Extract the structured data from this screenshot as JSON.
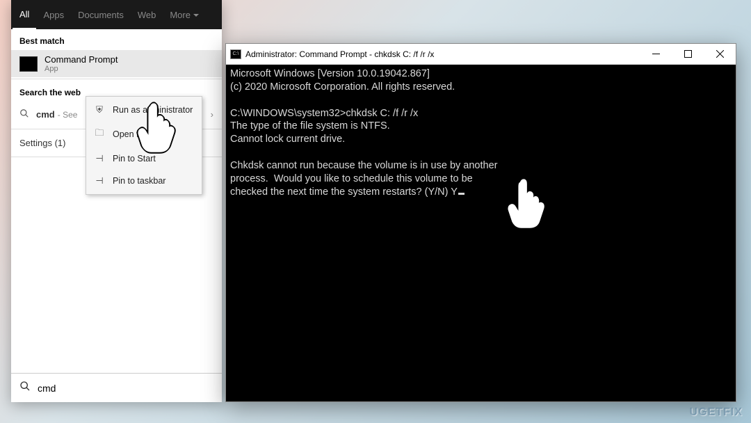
{
  "tabs": {
    "all": "All",
    "apps": "Apps",
    "documents": "Documents",
    "web": "Web",
    "more": "More"
  },
  "sections": {
    "bestmatch": "Best match",
    "searchweb": "Search the web",
    "settings": "Settings (1)"
  },
  "result": {
    "title": "Command Prompt",
    "sub": "App"
  },
  "webquery": {
    "q": "cmd",
    "hint": "- See ",
    "chevron": "›"
  },
  "searchbox": {
    "value": "cmd"
  },
  "context": {
    "runadmin": "Run as administrator",
    "openloc": "Open file lo",
    "pinstart": "Pin to Start",
    "pintask": "Pin to taskbar"
  },
  "cmdwin": {
    "title": "Administrator: Command Prompt - chkdsk  C: /f /r /x",
    "line1": "Microsoft Windows [Version 10.0.19042.867]",
    "line2": "(c) 2020 Microsoft Corporation. All rights reserved.",
    "line3": "C:\\WINDOWS\\system32>chkdsk C: /f /r /x",
    "line4": "The type of the file system is NTFS.",
    "line5": "Cannot lock current drive.",
    "line6": "Chkdsk cannot run because the volume is in use by another",
    "line7": "process.  Would you like to schedule this volume to be",
    "line8": "checked the next time the system restarts? (Y/N) Y"
  },
  "watermark": "UGETFIX"
}
